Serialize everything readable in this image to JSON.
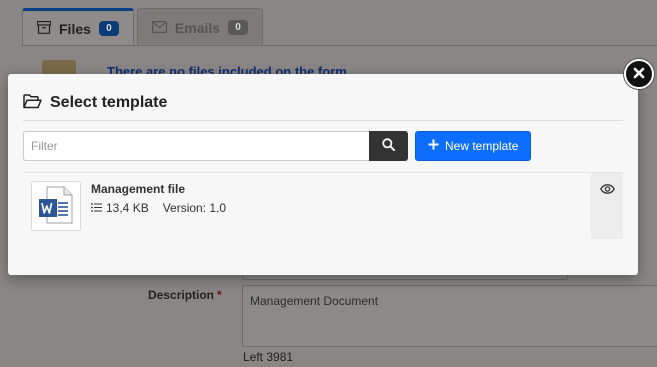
{
  "background": {
    "tabs": [
      {
        "label": "Files",
        "count": "0",
        "icon": "archive-icon"
      },
      {
        "label": "Emails",
        "count": "0",
        "icon": "envelope-icon"
      }
    ],
    "no_files_message": "There are no files included on the form",
    "description": {
      "label": "Description",
      "required_mark": "*",
      "value": "Management Document",
      "left_text": "Left 3981"
    }
  },
  "modal": {
    "title": "Select template",
    "icon": "folder-open-icon",
    "filter": {
      "placeholder": "Filter",
      "value": ""
    },
    "new_template_label": "New template",
    "templates": [
      {
        "name": "Management file",
        "size": "13,4 KB",
        "version": "Version: 1.0",
        "file_type": "word-document-icon"
      }
    ]
  },
  "colors": {
    "primary": "#0d6efd",
    "dark_button": "#333333",
    "word_blue": "#2b579a",
    "active_tab_accent": "#0a3f86"
  }
}
